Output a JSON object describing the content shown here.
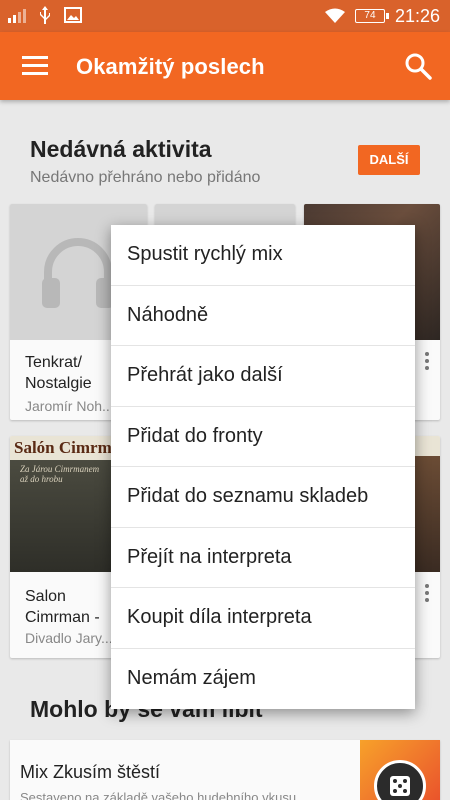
{
  "status_bar": {
    "time": "21:26",
    "battery": "74"
  },
  "app_bar": {
    "title": "Okamžitý poslech"
  },
  "recent": {
    "title": "Nedávná aktivita",
    "subtitle": "Nedávno přehráno nebo přidáno",
    "more_label": "DALŠÍ",
    "cards": [
      {
        "title": "Tenkrat/ Nostalgie",
        "subtitle": "Jaromír Noh..."
      },
      {
        "title": "Salon Cimrman -",
        "subtitle": "Divadlo Jary...",
        "art_text": "Salón Cimrman",
        "art_small": "Za Járou Cimrmanem až do hrobu"
      }
    ]
  },
  "popup_menu": {
    "items": [
      "Spustit rychlý mix",
      "Náhodně",
      "Přehrát jako další",
      "Přidat do fronty",
      "Přidat do seznamu skladeb",
      "Přejít na interpreta",
      "Koupit díla interpreta",
      "Nemám zájem"
    ]
  },
  "recommended": {
    "title": "Mohlo by se vám líbit",
    "mix_title": "Mix Zkusím štěstí",
    "mix_subtitle": "Sestaveno na základě vašeho hudebního vkusu"
  },
  "colors": {
    "accent": "#f26722",
    "status_bar": "#d9622b"
  }
}
